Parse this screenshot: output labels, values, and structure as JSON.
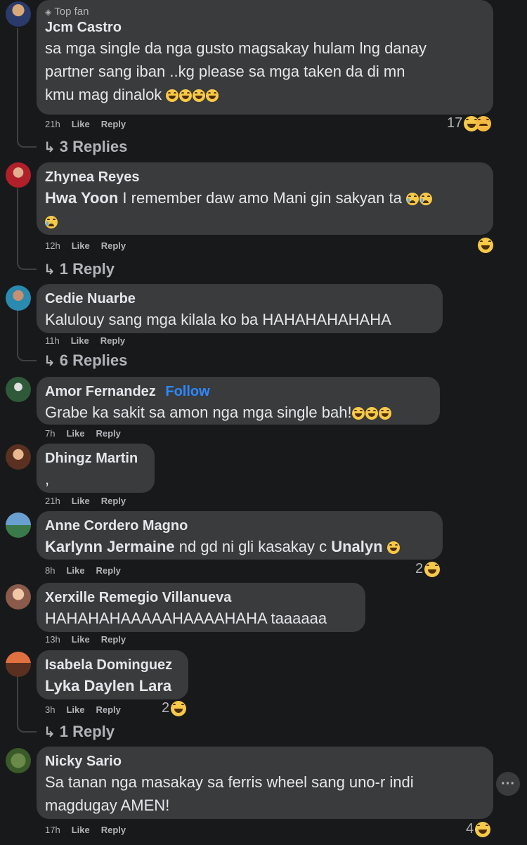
{
  "comments": [
    {
      "badge": "Top fan",
      "name": "Jcm Castro",
      "text_lines": [
        "sa mga single da nga gusto magsakay hulam lng danay",
        "partner sang iban ..kg please sa mga taken da di mn",
        "kmu mag dinalok"
      ],
      "time": "21h",
      "like": "Like",
      "reply": "Reply",
      "reaction_count": "17",
      "replies": "3 Replies"
    },
    {
      "name": "Zhynea Reyes",
      "mention": "Hwa Yoon",
      "text": " I remember daw amo Mani gin sakyan ta",
      "time": "12h",
      "like": "Like",
      "reply": "Reply",
      "replies": "1 Reply"
    },
    {
      "name": "Cedie Nuarbe",
      "text": "Kalulouy sang mga kilala ko ba HAHAHAHAHAHA",
      "time": "11h",
      "like": "Like",
      "reply": "Reply",
      "replies": "6 Replies"
    },
    {
      "name": "Amor Fernandez",
      "follow": "Follow",
      "text": "Grabe ka sakit sa amon nga mga single bah!",
      "time": "7h",
      "like": "Like",
      "reply": "Reply"
    },
    {
      "name": "Dhingz Martin",
      "text": ",",
      "time": "21h",
      "like": "Like",
      "reply": "Reply"
    },
    {
      "name": "Anne Cordero Magno",
      "mention": "Karlynn Jermaine",
      "text": " nd gd ni gli kasakay c ",
      "mention2": "Unalyn",
      "time": "8h",
      "like": "Like",
      "reply": "Reply",
      "reaction_count": "2"
    },
    {
      "name": "Xerxille Remegio Villanueva",
      "text": "HAHAHAHAAAAAHAAAAHAHA taaaaaa",
      "time": "13h",
      "like": "Like",
      "reply": "Reply"
    },
    {
      "name": "Isabela Dominguez",
      "mention": "Lyka Daylen Lara",
      "time": "3h",
      "like": "Like",
      "reply": "Reply",
      "reaction_count": "2",
      "replies": "1 Reply"
    },
    {
      "name": "Nicky Sario",
      "text_lines": [
        "Sa tanan nga masakay sa ferris wheel sang uno-r indi",
        "magdugay AMEN!"
      ],
      "time": "17h",
      "like": "Like",
      "reply": "Reply",
      "reaction_count": "4",
      "more": "···"
    }
  ],
  "colors": {
    "background": "#18191a",
    "bubble": "#3a3b3c",
    "text": "#e4e6eb",
    "muted": "#b0b3b8",
    "link": "#2d88ff"
  },
  "icons": [
    "diamond-icon",
    "reply-arrow-icon",
    "haha-emoji-icon",
    "sad-emoji-icon",
    "cry-emoji-icon",
    "more-icon"
  ]
}
